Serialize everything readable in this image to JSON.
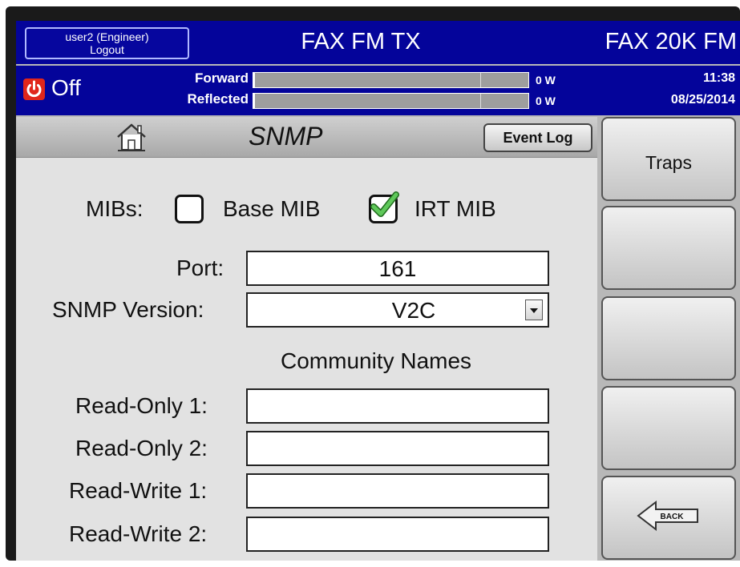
{
  "header": {
    "user_line1": "user2 (Engineer)",
    "user_line2": "Logout",
    "app_title": "FAX FM TX",
    "model": "FAX 20K FM"
  },
  "status": {
    "power_state": "Off",
    "forward_label": "Forward",
    "forward_value": "0 W",
    "reflected_label": "Reflected",
    "reflected_value": "0 W",
    "time": "11:38",
    "date": "08/25/2014",
    "forward_level": 0,
    "reflected_level": 0
  },
  "page": {
    "title": "SNMP",
    "event_log_label": "Event Log"
  },
  "mibs": {
    "label": "MIBs:",
    "base_label": "Base MIB",
    "base_checked": false,
    "irt_label": "IRT MIB",
    "irt_checked": true
  },
  "form": {
    "port_label": "Port:",
    "port_value": "161",
    "version_label": "SNMP Version:",
    "version_value": "V2C",
    "community_heading": "Community Names",
    "ro1_label": "Read-Only 1:",
    "ro1_value": "",
    "ro2_label": "Read-Only 2:",
    "ro2_value": "",
    "rw1_label": "Read-Write 1:",
    "rw1_value": "",
    "rw2_label": "Read-Write 2:",
    "rw2_value": ""
  },
  "sidebar": {
    "traps_label": "Traps",
    "back_label": "BACK"
  },
  "icons": {
    "power": "power-icon",
    "home": "home-icon",
    "check": "check-icon",
    "back_arrow": "back-arrow-icon"
  },
  "colors": {
    "header_bg": "#04049a",
    "power_red": "#e0261b",
    "check_green": "#3fa83a"
  }
}
